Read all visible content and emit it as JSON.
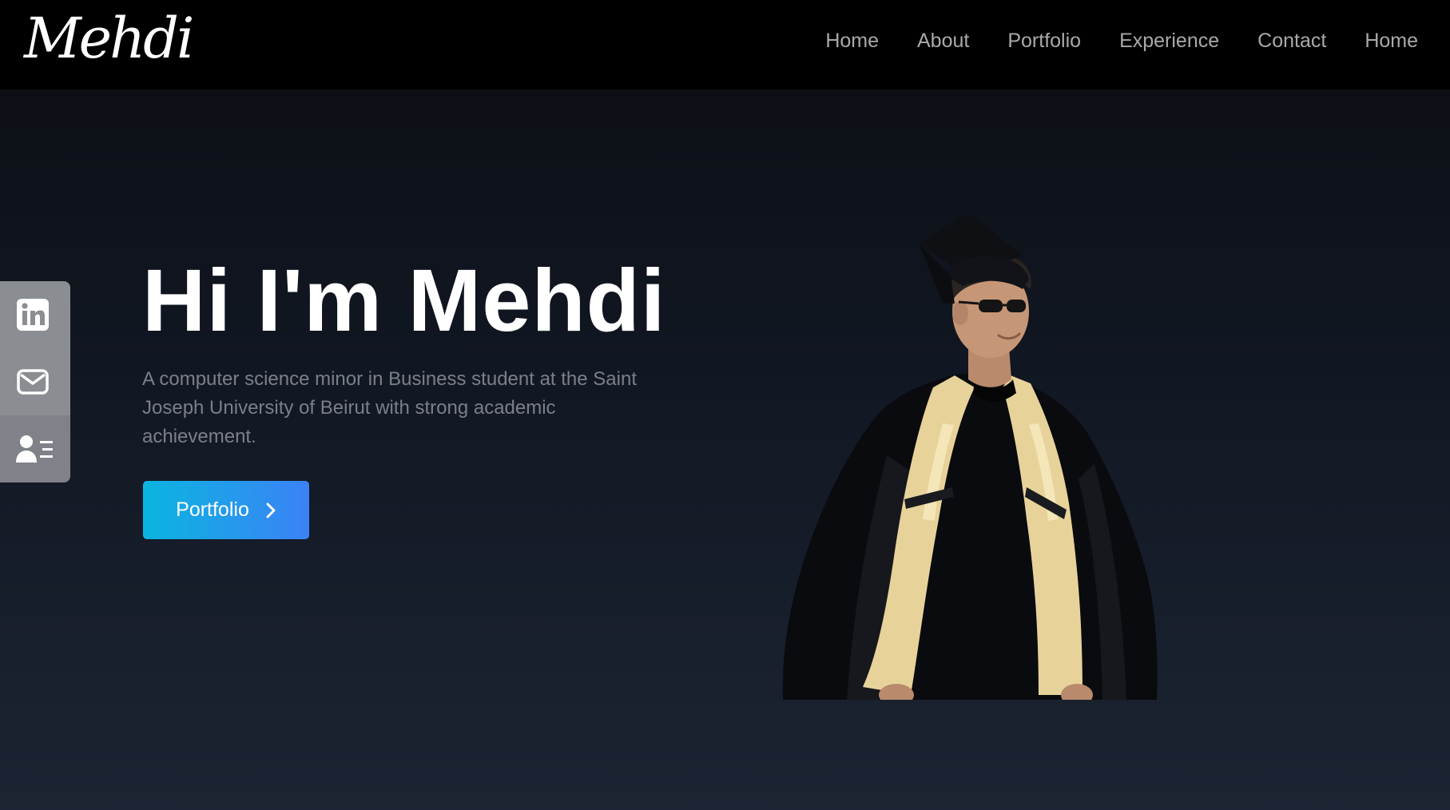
{
  "logo": {
    "text": "Mehdi"
  },
  "nav": {
    "items": [
      {
        "label": "Home"
      },
      {
        "label": "About"
      },
      {
        "label": "Portfolio"
      },
      {
        "label": "Experience"
      },
      {
        "label": "Contact"
      },
      {
        "label": "Home"
      }
    ]
  },
  "social": {
    "items": [
      {
        "icon": "linkedin-icon"
      },
      {
        "icon": "mail-icon"
      },
      {
        "icon": "resume-icon"
      }
    ]
  },
  "hero": {
    "title": "Hi I'm Mehdi",
    "description": "A computer science minor in Business student at the Saint Joseph University of Beirut with strong academic achievement.",
    "cta_label": "Portfolio"
  },
  "colors": {
    "accent_start": "#0bb5e0",
    "accent_end": "#3b82f6",
    "navbar_bg": "#000000",
    "social_bg": "#8a8d92"
  }
}
